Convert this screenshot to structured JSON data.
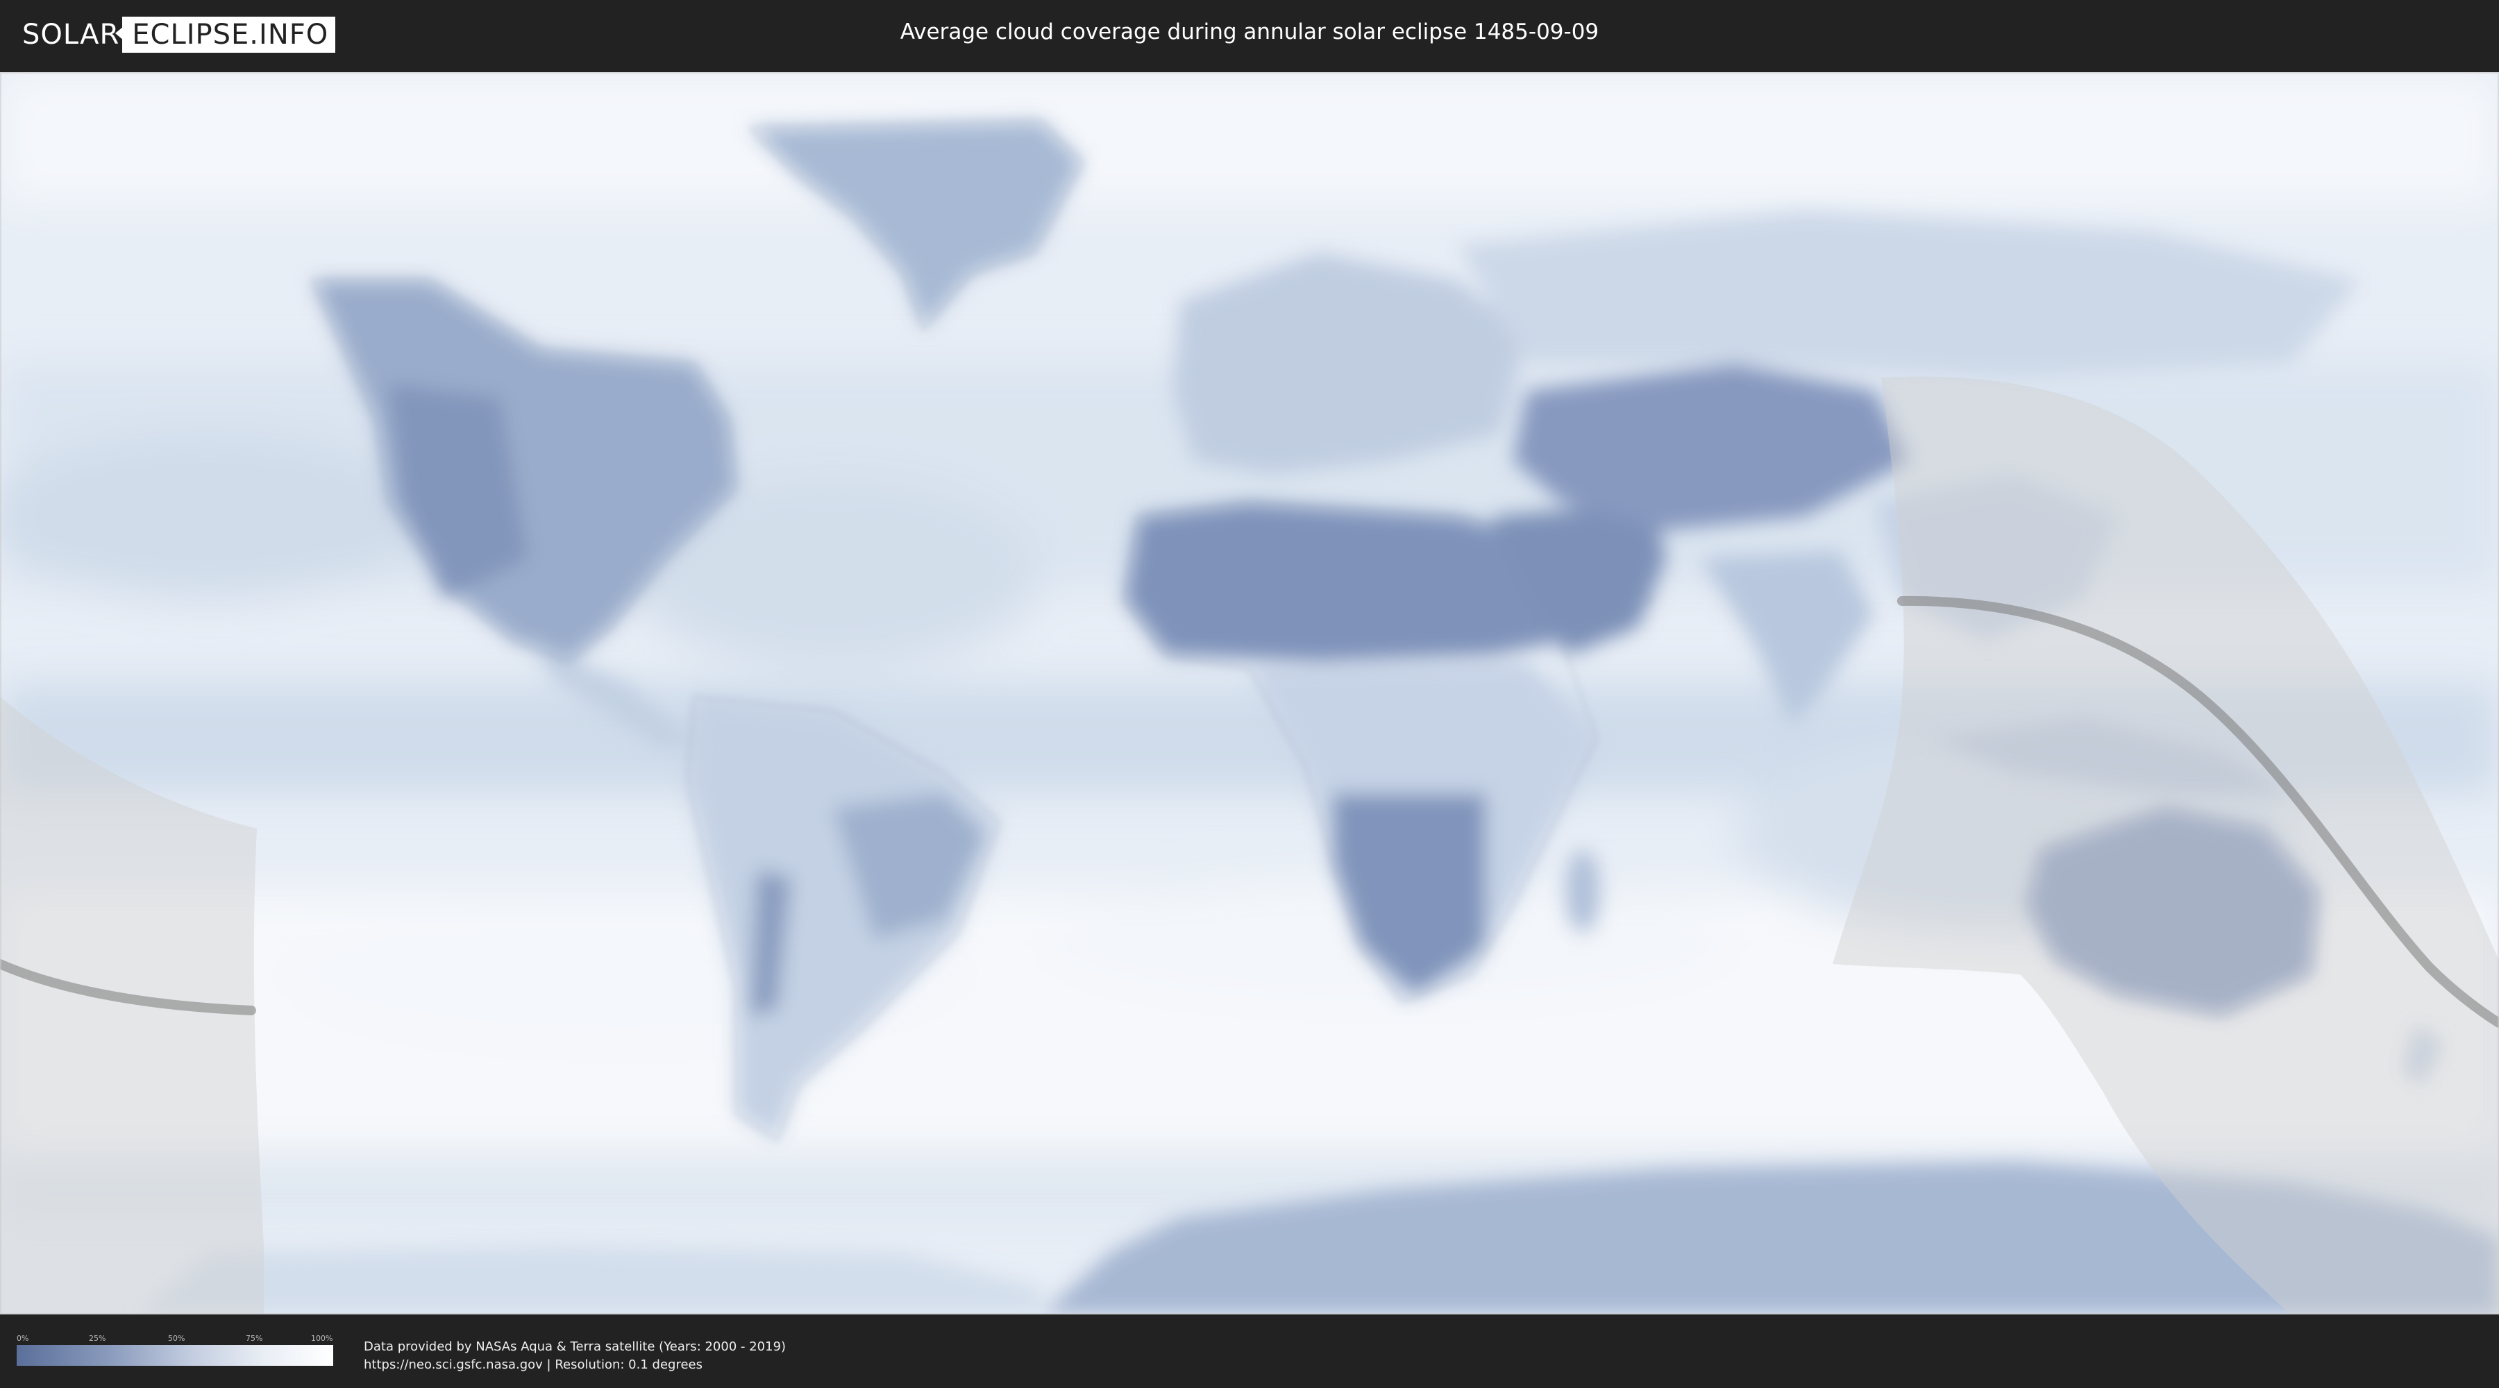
{
  "header": {
    "logo_part1": "SOLAR",
    "logo_part2": "ECLIPSE.INFO",
    "title": "Average cloud coverage during annular solar eclipse 1485-09-09"
  },
  "map": {
    "type": "world cloud coverage map",
    "projection": "equirectangular",
    "colors": {
      "clear": "#5a6f9a",
      "cloudy": "#ffffff",
      "eclipse_overlay": "#cfcfcf",
      "centerline": "#7a7a7a",
      "ocean_base": "#e9eff6"
    }
  },
  "legend": {
    "ticks": [
      "0%",
      "25%",
      "50%",
      "75%",
      "100%"
    ]
  },
  "footer": {
    "credit_line1": "Data provided by NASAs Aqua & Terra satellite (Years: 2000 - 2019)",
    "credit_line2": "https://neo.sci.gsfc.nasa.gov | Resolution: 0.1 degrees"
  }
}
